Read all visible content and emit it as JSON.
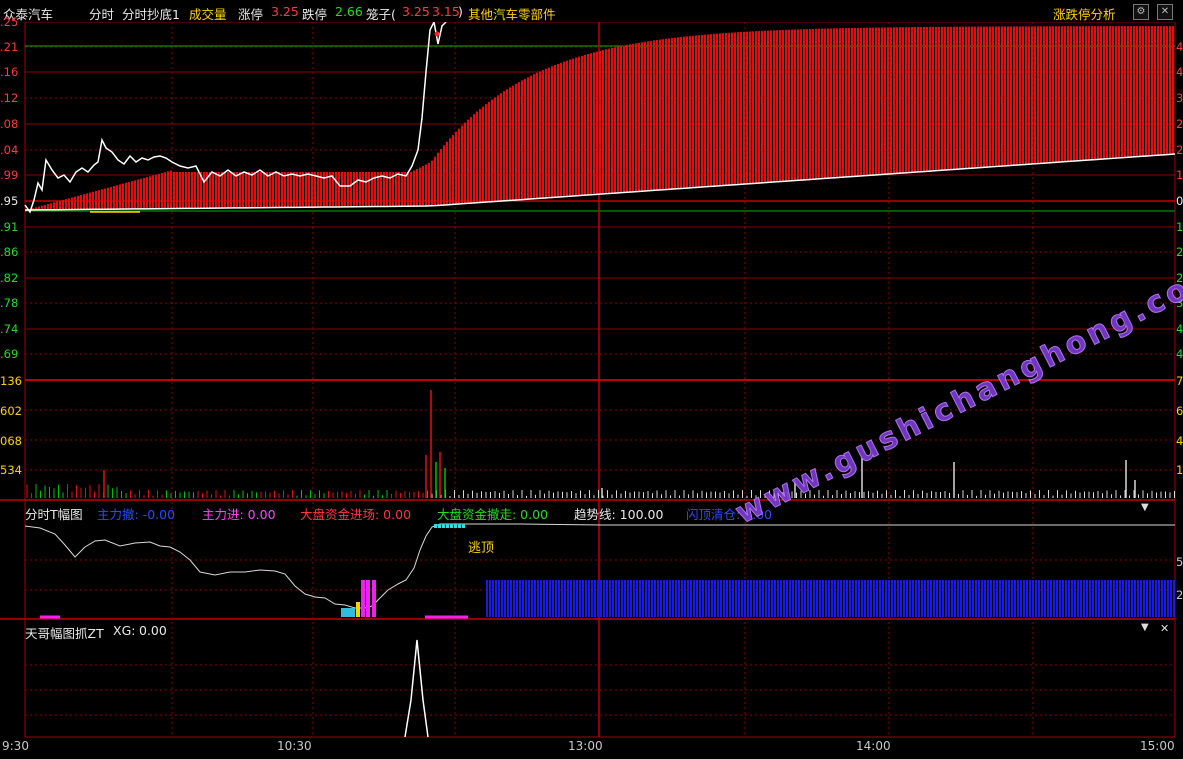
{
  "topbar": {
    "stock_name": "众泰汽车",
    "mode": "分时",
    "indicator": "分时抄底1",
    "volume_label": "成交量",
    "limit_up_label": "涨停",
    "limit_up_value": "3.25",
    "limit_down_label": "跌停",
    "limit_down_value": "2.66",
    "cage_label": "笼子(",
    "cage_low": "3.25",
    "cage_high": "3.15",
    "cage_close": ")",
    "sector": "其他汽车零部件",
    "analysis_button": "涨跌停分析",
    "settings_icon": "gear-icon",
    "close_icon": "close-icon"
  },
  "price_axis": {
    "left_labels": [
      ".25",
      ".21",
      ".16",
      ".12",
      ".08",
      ".04",
      ".99",
      ".95",
      ".91",
      ".86",
      ".82",
      ".78",
      ".74",
      ".69"
    ],
    "right_labels": [
      "",
      "4",
      "4",
      "3",
      "2",
      "2",
      "1",
      "0",
      "1",
      "2",
      "2",
      "3",
      "4",
      "4"
    ]
  },
  "volume_axis": {
    "left_labels": [
      "136",
      "602",
      "068",
      "534"
    ],
    "right_labels": [
      "7",
      "6",
      "4",
      "1"
    ]
  },
  "panel_t": {
    "name": "分时T幅图",
    "items": [
      {
        "label": "主力撤:",
        "value": "-0.00",
        "color": "#2a4bff"
      },
      {
        "label": "主力进:",
        "value": "0.00",
        "color": "#ff44ff"
      },
      {
        "label": "大盘资金进场:",
        "value": "0.00",
        "color": "#ff3b3b"
      },
      {
        "label": "大盘资金撤走:",
        "value": "0.00",
        "color": "#22dd22"
      },
      {
        "label": "趋势线:",
        "value": "100.00",
        "color": "#e8e8e8"
      },
      {
        "label": "闪顶清仓:",
        "value": "0.00",
        "color": "#2a4bff"
      }
    ],
    "annotation": "逃顶",
    "right_labels": [
      "5",
      "2"
    ],
    "menu_icon": "triangle-down-icon"
  },
  "panel_zt": {
    "name": "天哥幅图抓ZT",
    "xg_label": "XG:",
    "xg_value": "0.00",
    "menu_icon": "triangle-down-icon",
    "close_icon": "close-icon"
  },
  "time_axis": [
    "9:30",
    "10:30",
    "13:00",
    "14:00",
    "15:00"
  ],
  "watermark": "www.gushichanghong.com",
  "colors": {
    "up": "#ff2020",
    "down": "#00d000",
    "price_line": "#ffffff",
    "avg_line": "#ffffff",
    "grid": "#8b0000",
    "sector": "#ffd200"
  }
}
